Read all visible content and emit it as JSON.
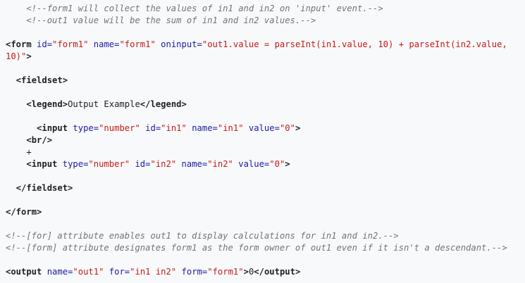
{
  "lines": {
    "c1": "<!--form1 will collect the values of in1 and in2 on 'input' event.-->",
    "c2": "<!--out1 value will be the sum of in1 and in2 values.-->",
    "form_open_tag": "<form",
    "form_attr_id": "id=",
    "form_id_val": "\"form1\"",
    "form_attr_name": "name=",
    "form_name_val": "\"form1\"",
    "form_attr_oninput": "oninput=",
    "form_oninput_val_1": "\"out1.value = parseInt(in1.value, 10) + parseInt(in2.value,",
    "form_oninput_val_2": "10)\"",
    "gt": ">",
    "fieldset_open": "<fieldset>",
    "legend_open": "<legend>",
    "legend_text": "Output Example",
    "legend_close": "</legend>",
    "input_tag": "<input",
    "attr_type": "type=",
    "val_number": "\"number\"",
    "attr_id": "id=",
    "val_in1": "\"in1\"",
    "attr_name": "name=",
    "attr_value": "value=",
    "val_zero": "\"0\"",
    "br_tag": "<br/>",
    "plus": "+",
    "val_in2": "\"in2\"",
    "fieldset_close": "</fieldset>",
    "form_close": "</form>",
    "c3": "<!--[for] attribute enables out1 to display calculations for in1 and in2.-->",
    "c4": "<!--[form] attribute designates form1 as the form owner of out1 even if it isn't a descendant.-->",
    "output_tag": "<output",
    "output_name_val": "\"out1\"",
    "attr_for": "for=",
    "output_for_val": "\"in1 in2\"",
    "attr_form": "form=",
    "output_form_val": "\"form1\"",
    "output_text": "0",
    "output_close": "</output>"
  }
}
